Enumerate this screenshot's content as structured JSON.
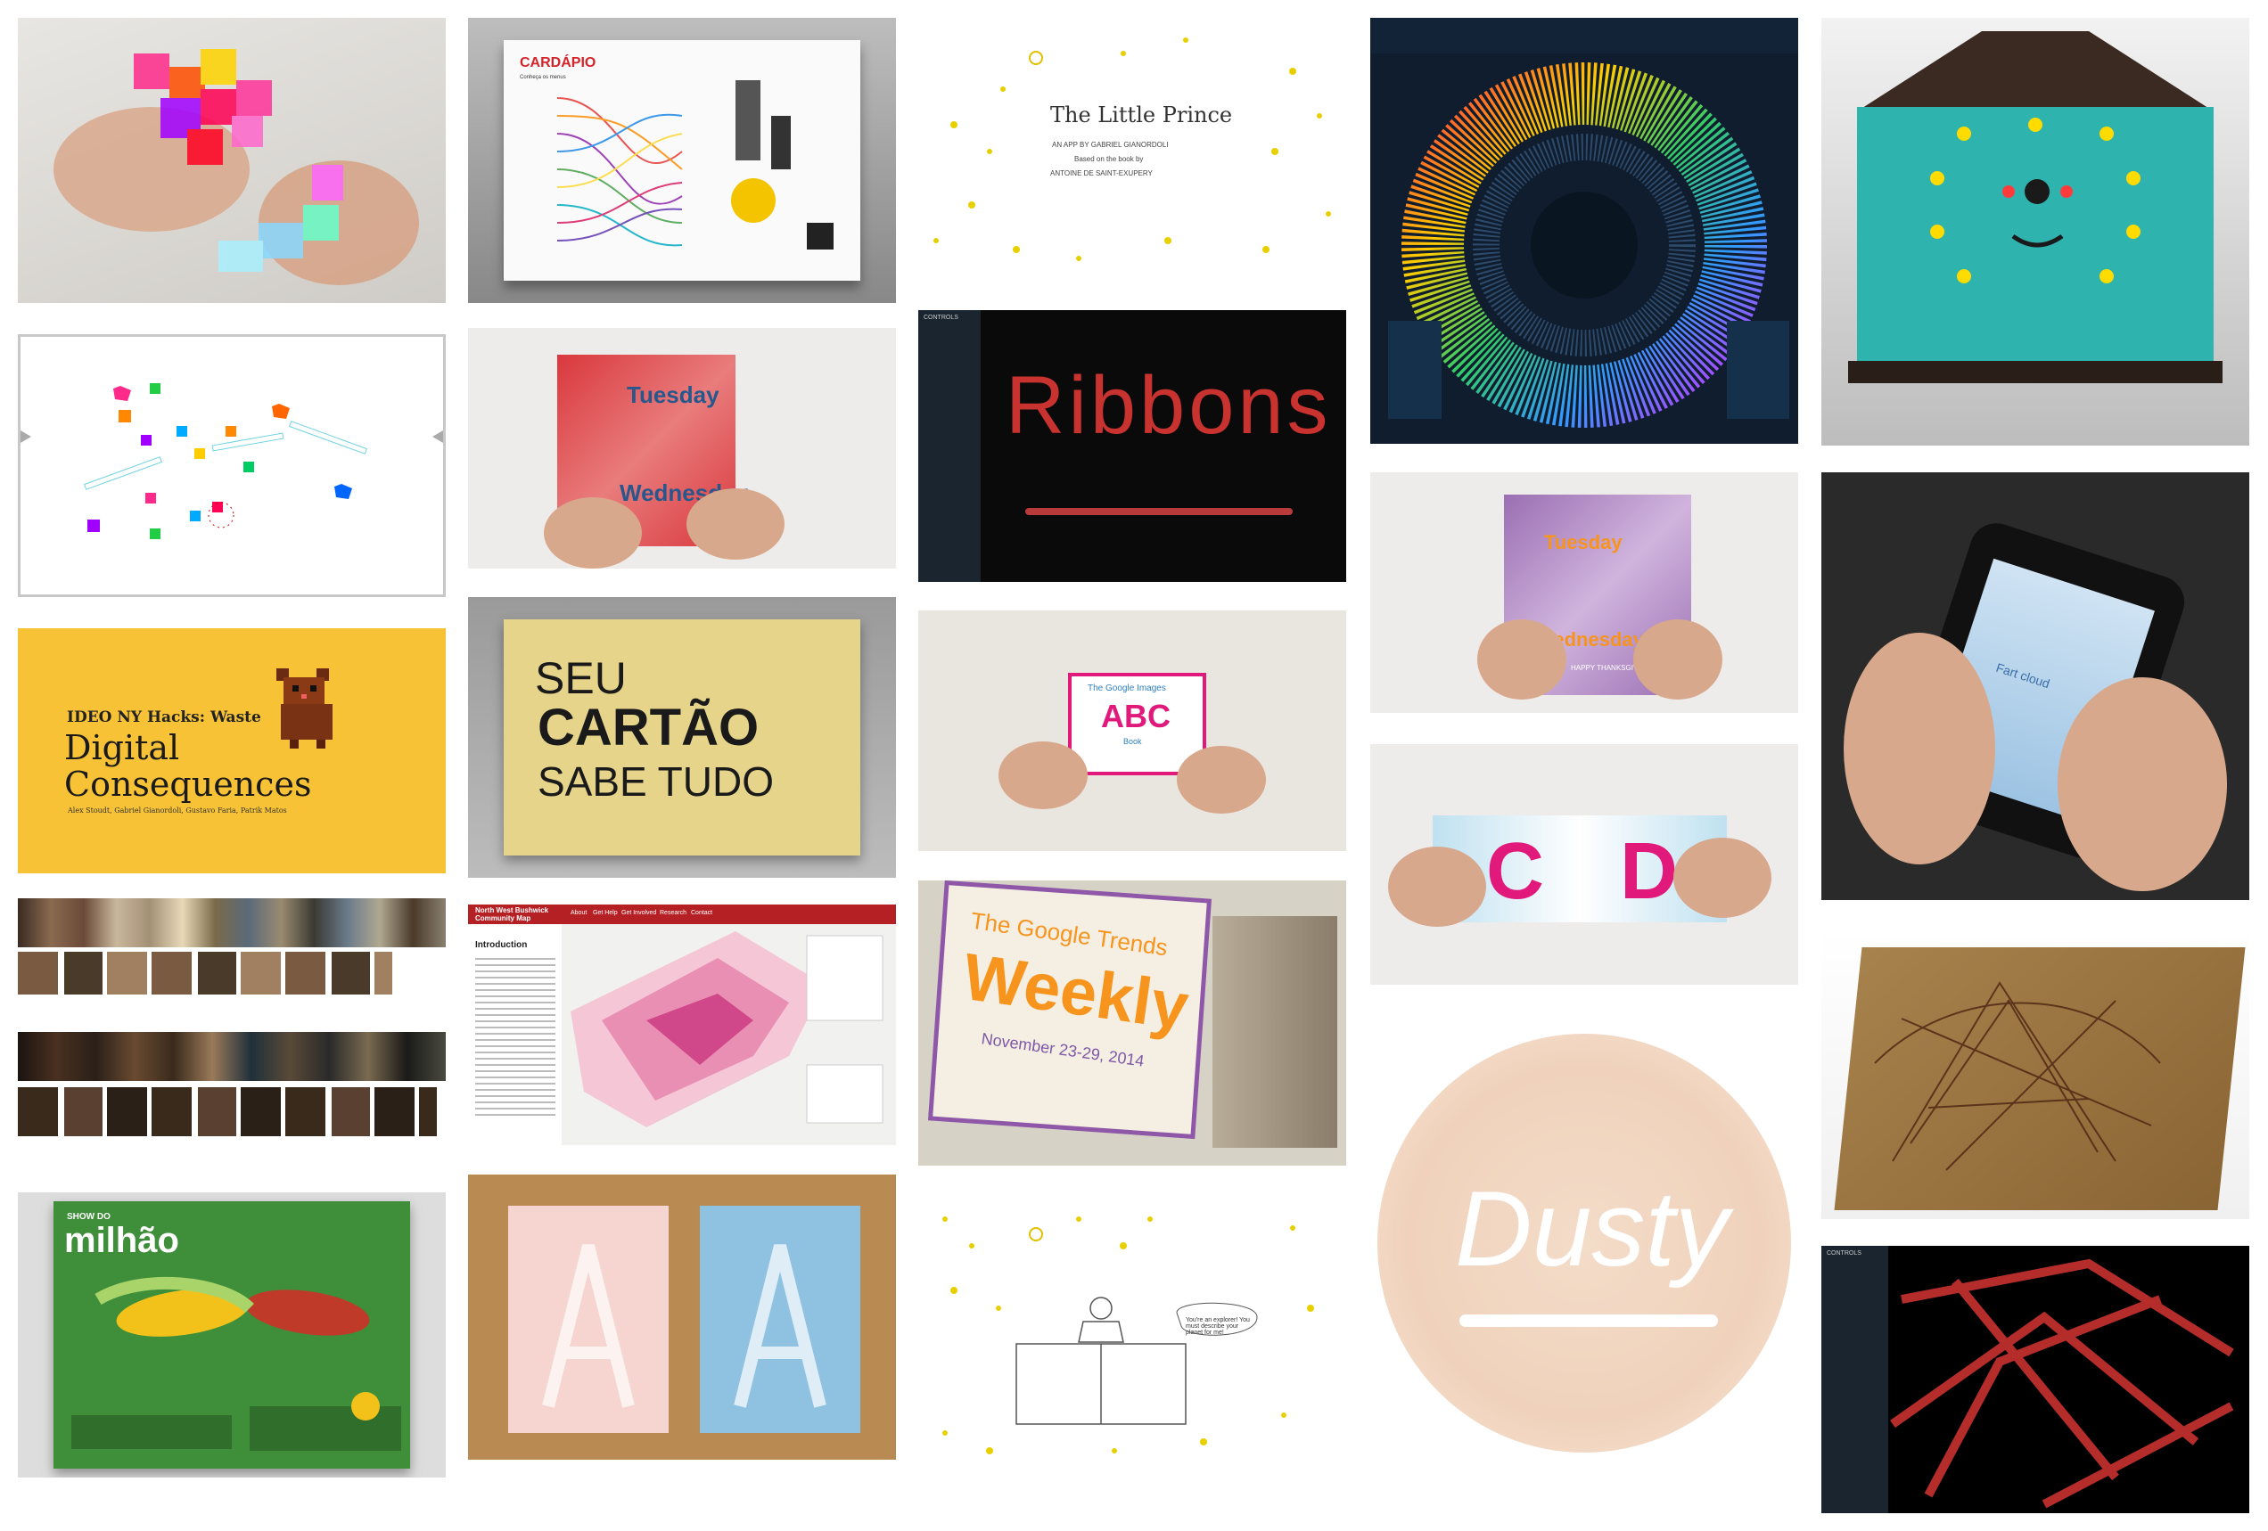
{
  "portfolio": {
    "cardapio": {
      "title": "CARDÁPIO",
      "subtitle": "Conheça os menus"
    },
    "little_prince": {
      "title": "The Little Prince",
      "line1": "AN APP BY GABRIEL GIANORDOLI",
      "line2": "Based on the book by",
      "line3": "ANTOINE DE SAINT-EXUPERY"
    },
    "ribbons": {
      "word": "Ribbons",
      "panel_title": "CONTROLS"
    },
    "ideo": {
      "kicker": "IDEO NY Hacks: Waste",
      "title_line1": "Digital",
      "title_line2": "Consequences",
      "credits": "Alex Stoudt, Gabriel Gianordoli, Gustavo Faria, Patrik Matos"
    },
    "tuesday_wednesday": {
      "word1": "Tuesday",
      "word2": "Wednesday"
    },
    "thanksgiving": {
      "word1": "Tuesday",
      "word2": "Wednesday",
      "footer": "HAPPY THANKSGIVING"
    },
    "cartao": {
      "line1": "SEU",
      "line2": "CARTÃO",
      "line3": "SABE TUDO"
    },
    "abc_book": {
      "kicker": "The Google Images",
      "big": "ABC",
      "small": "Book"
    },
    "cd_book": {
      "left": "C",
      "right": "D"
    },
    "phone": {
      "label": "Fart cloud"
    },
    "bushwick": {
      "title_line1": "North West Bushwick",
      "title_line2": "Community Map",
      "nav": [
        "About",
        "Get Help",
        "Get Involved",
        "Research",
        "Contact"
      ],
      "heading": "Introduction"
    },
    "trends": {
      "title_line1": "The Google Trends",
      "big": "Weekly",
      "dates": "November 23-29, 2014"
    },
    "milhao": {
      "kicker": "SHOW DO",
      "title": "milhão"
    },
    "dusty": {
      "word": "Dusty"
    },
    "prince_scene": {
      "bubble": "You're an explorer! You must describe your planet for me!"
    }
  },
  "colors": {
    "ideo_yellow": "#F7C236",
    "ribbon_red": "#C8322F",
    "teal": "#2FB3AF",
    "pink": "#E7177E",
    "orange": "#F7941D",
    "purple": "#7E58A7"
  }
}
